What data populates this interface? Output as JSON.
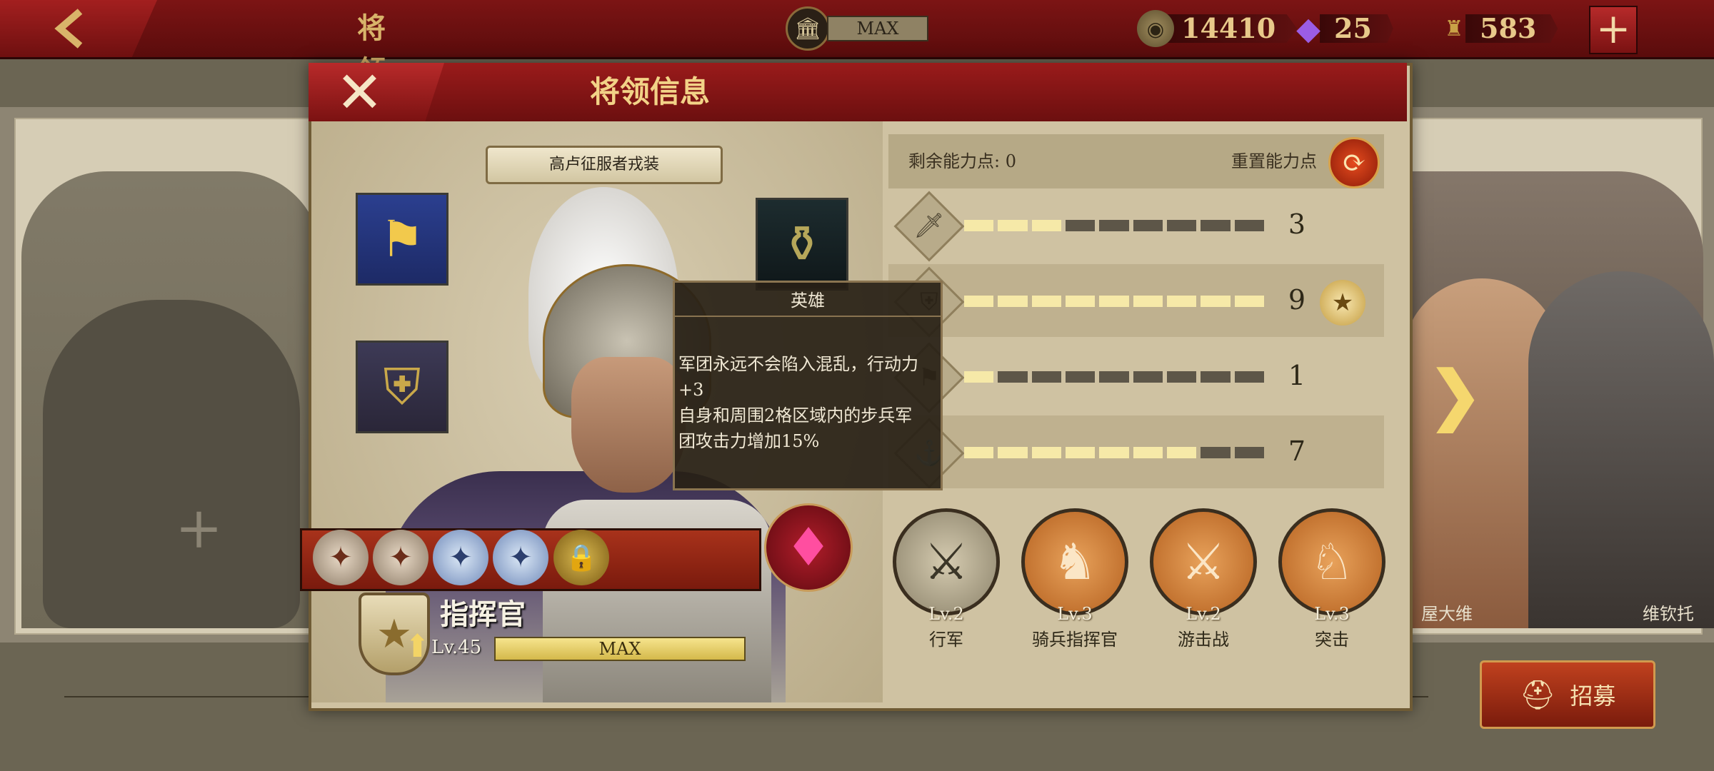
{
  "topbar": {
    "title": "将 领",
    "max_label": "MAX",
    "coins": "14410",
    "gems": "25",
    "spqr": "583",
    "plus": "+"
  },
  "dialog": {
    "title": "将领信息",
    "close": "✕"
  },
  "outfit": {
    "label": "高卢征服者戎装"
  },
  "tooltip": {
    "title": "英雄",
    "text": "军团永远不会陷入混乱，行动力\n+3\n自身和周围2格区域内的步兵军\n团攻击力增加15%"
  },
  "commander": {
    "title": "指挥官",
    "level": "Lv.45",
    "xp_label": "MAX",
    "xp_fraction": 1.0
  },
  "stats": {
    "points_label": "剩余能力点: 0",
    "reset_label": "重置能力点",
    "rows": [
      {
        "icon": "sword-icon",
        "value": "3",
        "filled": 3
      },
      {
        "icon": "shield-icon",
        "value": "9",
        "filled": 9
      },
      {
        "icon": "flag-icon",
        "value": "1",
        "filled": 1
      },
      {
        "icon": "anchor-icon",
        "value": "7",
        "filled": 7
      }
    ],
    "max_segments": 9
  },
  "skills": [
    {
      "level": "Lv.2",
      "name": "行军"
    },
    {
      "level": "Lv.3",
      "name": "骑兵指挥官"
    },
    {
      "level": "Lv.2",
      "name": "游击战"
    },
    {
      "level": "Lv.3",
      "name": "突击"
    }
  ],
  "side_heroes": {
    "right_a": "屋大维",
    "right_b": "维钦托"
  },
  "recruit": {
    "label": "招募"
  },
  "colors": {
    "accent_red": "#7c1414",
    "gold": "#e8c98a",
    "bar_on": "#f6e9a8",
    "bar_off": "#5d5648"
  }
}
